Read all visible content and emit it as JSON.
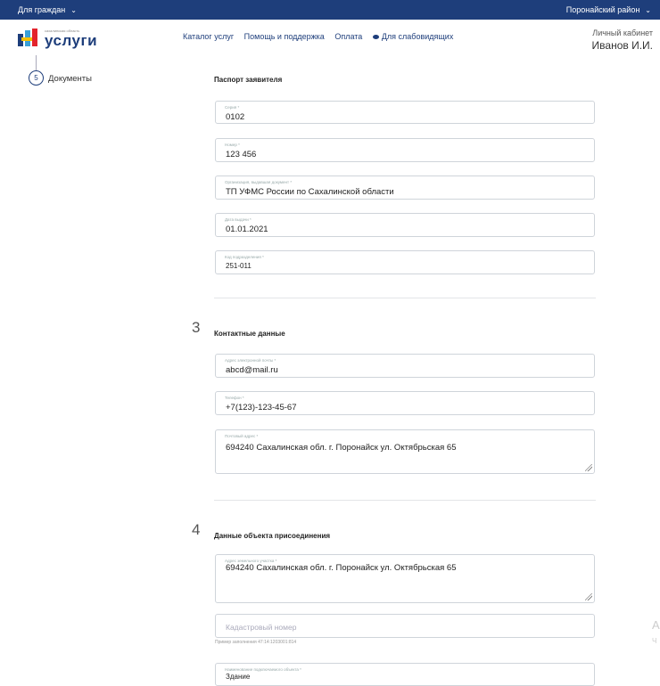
{
  "topbar": {
    "left": "Для граждан",
    "right": "Поронайский район"
  },
  "logo": {
    "small": "сахалинская область",
    "big": "услуги"
  },
  "nav": [
    "Каталог услуг",
    "Помощь и поддержка",
    "Оплата",
    "Для слабовидящих"
  ],
  "cabinet": {
    "label": "Личный кабинет",
    "user": "Иванов И.И."
  },
  "step": {
    "number": "5",
    "label": "Документы"
  },
  "passport": {
    "title": "Паспорт заявителя",
    "fields": [
      {
        "label": "Серия *",
        "value": "0102"
      },
      {
        "label": "Номер *",
        "value": "123 456"
      },
      {
        "label": "Организация, выдавшая документ *",
        "value": "ТП УФМС России по Сахалинской области"
      },
      {
        "label": "Дата выдачи *",
        "value": "01.01.2021"
      },
      {
        "label": "Код подразделения *",
        "value": "251-011"
      }
    ]
  },
  "contacts": {
    "num": "3",
    "title": "Контактные данные",
    "fields": [
      {
        "label": "Адрес электронной почты *",
        "value": "abcd@mail.ru"
      },
      {
        "label": "Телефон *",
        "value": "+7(123)-123-45-67"
      },
      {
        "label": "Почтовый адрес *",
        "value": "694240 Сахалинская обл. г. Поронайск ул. Октябрьская 65"
      }
    ]
  },
  "object": {
    "num": "4",
    "title": "Данные объекта присоединения",
    "fields": [
      {
        "label": "Адрес земельного участка *",
        "value": "694240 Сахалинская обл. г. Поронайск ул. Октябрьская 65"
      },
      {
        "placeholder": "Кадастровый номер",
        "hint": "Пример заполнения 47:14:1203001:814"
      },
      {
        "label": "Наименование подключаемого объекта *",
        "value": "Здание"
      }
    ]
  },
  "edge": [
    "А",
    "Ч"
  ]
}
